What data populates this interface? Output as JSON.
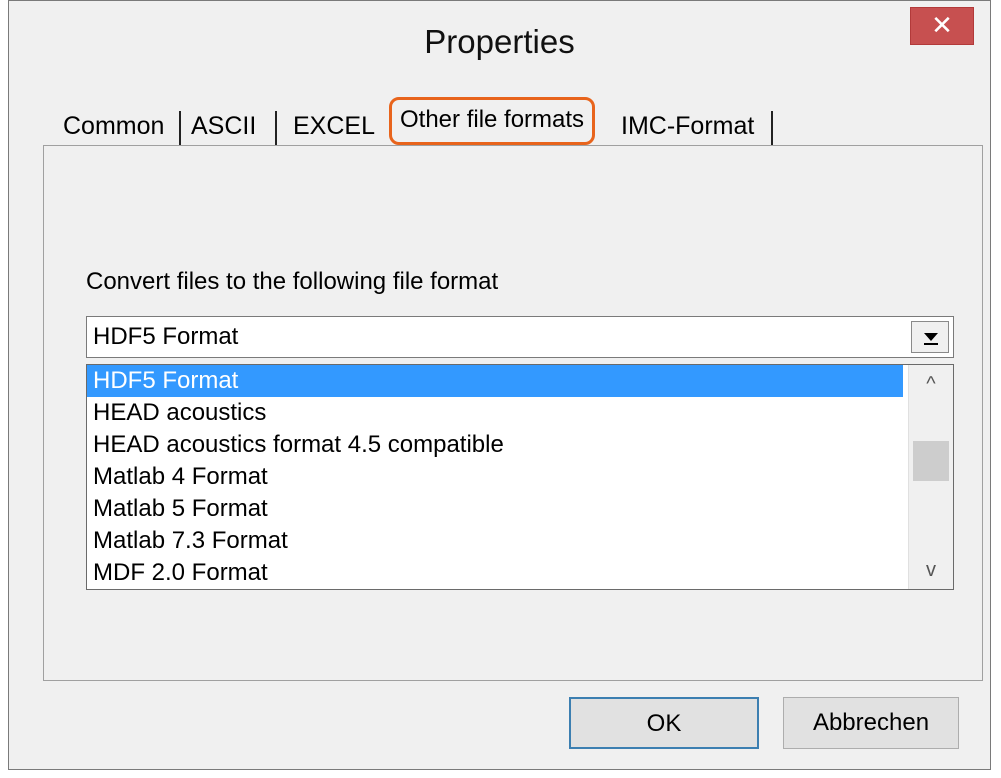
{
  "window": {
    "title": "Properties",
    "close_glyph": "✕"
  },
  "tabs": [
    {
      "label": "Common"
    },
    {
      "label": "ASCII"
    },
    {
      "label": "EXCEL"
    },
    {
      "label": "Other file formats",
      "active": true
    },
    {
      "label": "IMC-Format"
    }
  ],
  "panel": {
    "label": "Convert files to the following file format",
    "combo": {
      "selected": "HDF5 Format"
    },
    "list": {
      "items": [
        "HDF5 Format",
        "HEAD acoustics",
        "HEAD acoustics format 4.5 compatible",
        "Matlab 4 Format",
        "Matlab 5 Format",
        "Matlab 7.3 Format",
        "MDF 2.0 Format"
      ],
      "selected_index": 0
    },
    "scroll_up_glyph": "^",
    "scroll_down_glyph": "v"
  },
  "buttons": {
    "ok": "OK",
    "cancel": "Abbrechen"
  },
  "colors": {
    "selection": "#3399ff",
    "highlight": "#e8641c",
    "close": "#c75050"
  },
  "icons": [
    "close-icon",
    "dropdown-arrow-icon",
    "scroll-up-icon",
    "scroll-down-icon"
  ]
}
